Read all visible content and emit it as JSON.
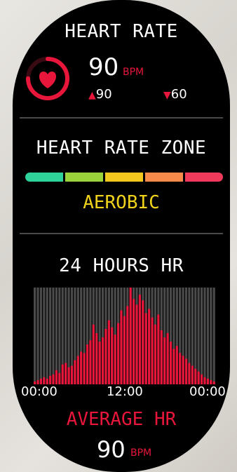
{
  "heart_rate": {
    "title": "HEART RATE",
    "value": "90",
    "unit": "BPM",
    "max": "90",
    "min": "60",
    "ring_fraction": 0.75
  },
  "zone": {
    "title": "HEART RATE ZONE",
    "colors": [
      "#2fd39a",
      "#9ad43a",
      "#f2c81e",
      "#f58a4a",
      "#ef3a5c"
    ],
    "current": "AEROBIC"
  },
  "history": {
    "title": "24 HOURS HR",
    "ticks": [
      "00:00",
      "12:00",
      "00:00"
    ],
    "avg_label": "AVERAGE HR",
    "avg_value": "90",
    "avg_unit": "BPM"
  },
  "colors": {
    "accent": "#e8163a",
    "zone_text": "#f0d21a"
  },
  "chart_data": {
    "type": "bar",
    "x": [
      "00:00",
      "12:00",
      "00:00"
    ],
    "values": [
      4,
      6,
      8,
      10,
      8,
      12,
      14,
      20,
      16,
      28,
      30,
      24,
      26,
      34,
      40,
      46,
      44,
      56,
      62,
      84,
      72,
      60,
      66,
      78,
      90,
      80,
      70,
      86,
      104,
      96,
      110,
      136,
      120,
      112,
      126,
      118,
      100,
      106,
      94,
      84,
      98,
      76,
      66,
      72,
      60,
      50,
      54,
      44,
      40,
      36,
      30,
      26,
      22,
      18,
      14,
      10,
      8,
      6,
      4
    ],
    "ylim": [
      0,
      136
    ]
  }
}
